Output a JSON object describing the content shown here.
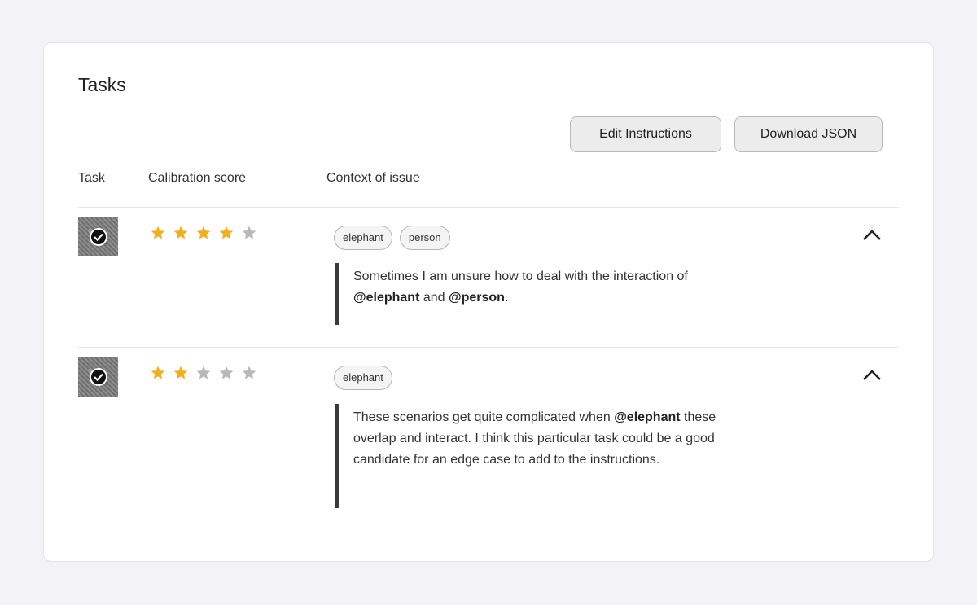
{
  "page": {
    "title": "Tasks"
  },
  "toolbar": {
    "edit_label": "Edit Instructions",
    "download_label": "Download JSON"
  },
  "table": {
    "headers": {
      "task": "Task",
      "score": "Calibration score",
      "context": "Context of issue"
    },
    "rows": [
      {
        "rating": 4,
        "tags": [
          "elephant",
          "person"
        ],
        "comment": {
          "before": "Sometimes I am unsure how to deal with the interaction of",
          "mention1": "@elephant",
          "middle": " and ",
          "mention2": "@person",
          "after": "."
        }
      },
      {
        "rating": 2,
        "tags": [
          "elephant"
        ],
        "comment": {
          "before": "These scenarios get quite complicated when ",
          "mention1": "@elephant",
          "after": " these overlap and interact. I think this particular task could be a good candidate for an edge case to add to the instructions."
        }
      }
    ]
  },
  "colors": {
    "star_filled": "#f2b01e",
    "star_empty": "#b8b8b8",
    "background": "#f3f3f7"
  }
}
